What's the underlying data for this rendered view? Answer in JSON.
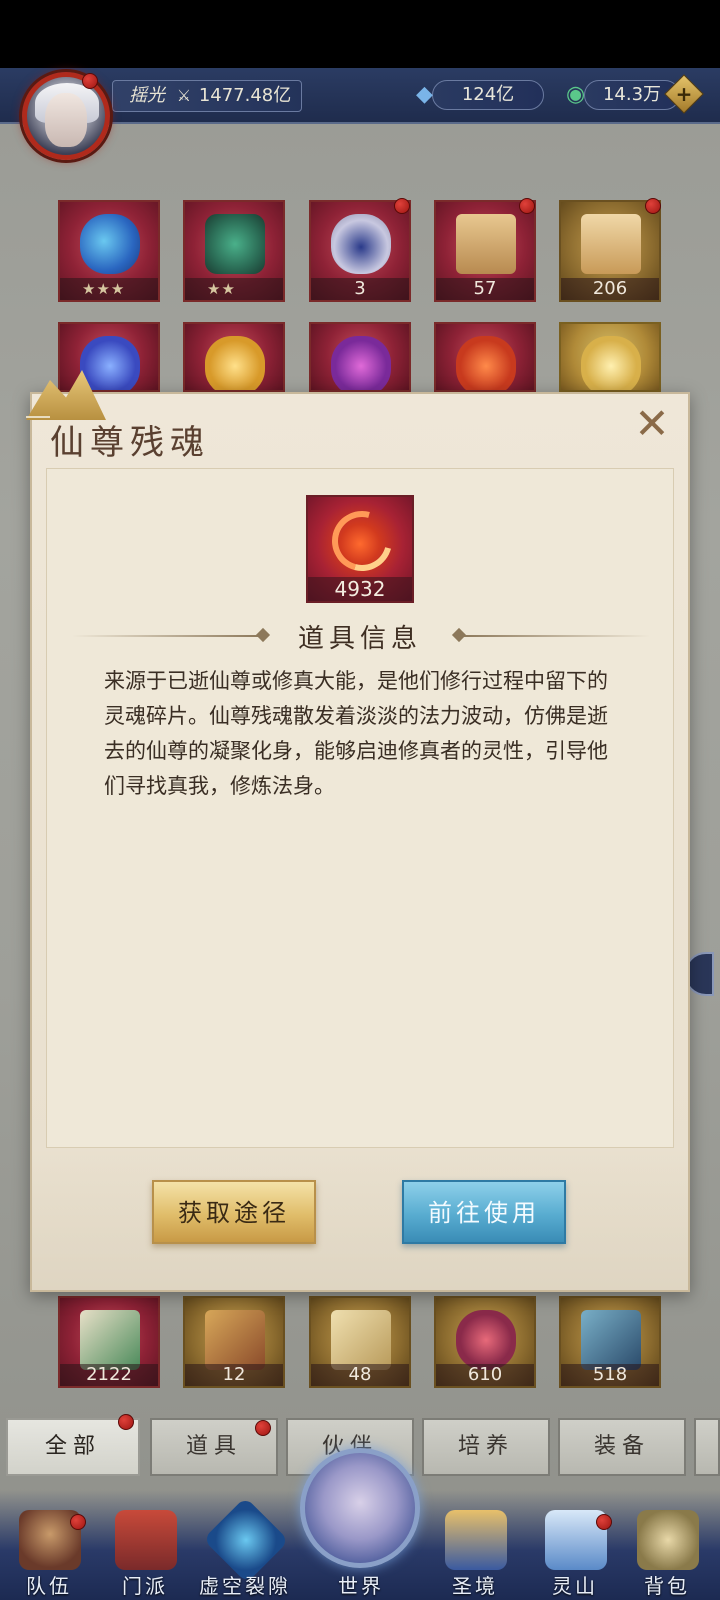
{
  "header": {
    "player_name": "摇光",
    "power": "1477.48亿",
    "resource1": "124亿",
    "resource2": "14.3万",
    "add_label": "+"
  },
  "inventory_top": [
    {
      "type": "stars",
      "label": "★★★"
    },
    {
      "type": "stars",
      "label": "★★"
    },
    {
      "type": "count",
      "label": "3"
    },
    {
      "type": "count",
      "label": "57"
    },
    {
      "type": "count",
      "label": "206"
    }
  ],
  "inventory_bottom": [
    {
      "label": "2122"
    },
    {
      "label": "12"
    },
    {
      "label": "48"
    },
    {
      "label": "610"
    },
    {
      "label": "518"
    }
  ],
  "modal": {
    "title": "仙尊残魂",
    "close_label": "✕",
    "item_count": "4932",
    "section_title": "道具信息",
    "description": "来源于已逝仙尊或修真大能，是他们修行过程中留下的灵魂碎片。仙尊残魂散发着淡淡的法力波动，仿佛是逝去的仙尊的凝聚化身，能够启迪修真者的灵性，引导他们寻找真我，修炼法身。",
    "btn_obtain": "获取途径",
    "btn_use": "前往使用"
  },
  "tabs": [
    "全部",
    "道具",
    "伙伴",
    "培养",
    "装备"
  ],
  "nav": [
    "队伍",
    "门派",
    "虚空裂隙",
    "世界",
    "圣境",
    "灵山",
    "背包"
  ],
  "colors": {
    "header_bg": "#22305a",
    "modal_bg": "#efe8d8",
    "btn_gold": "#e0bd6a",
    "btn_blue": "#58acd0",
    "badge_red": "#c8251d"
  }
}
